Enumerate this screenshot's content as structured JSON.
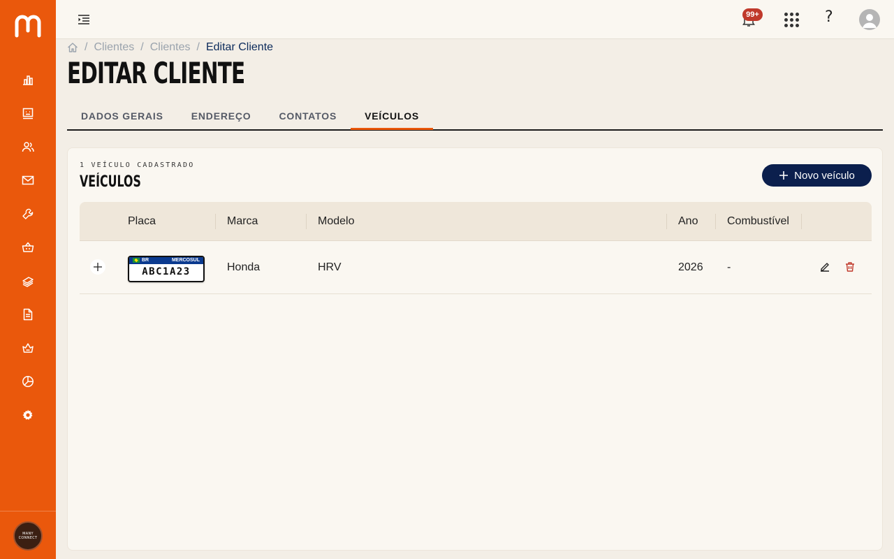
{
  "sidebar": {
    "items": [
      {
        "icon": "chart-bar-icon"
      },
      {
        "icon": "board-icon"
      },
      {
        "icon": "users-icon"
      },
      {
        "icon": "mail-icon"
      },
      {
        "icon": "wrench-icon"
      },
      {
        "icon": "basket-icon"
      },
      {
        "icon": "money-icon"
      },
      {
        "icon": "document-icon"
      },
      {
        "icon": "crown-basket-icon"
      },
      {
        "icon": "pie-chart-icon"
      },
      {
        "icon": "gear-icon"
      }
    ],
    "account_avatar_line1": "MANY",
    "account_avatar_line2": "CONNECT"
  },
  "topbar": {
    "notification_count": "99+"
  },
  "breadcrumb": {
    "items": [
      "Clientes",
      "Clientes"
    ],
    "current": "Editar Cliente",
    "separator": "/"
  },
  "page": {
    "title": "EDITAR CLIENTE"
  },
  "tabs": [
    {
      "label": "DADOS GERAIS",
      "active": false
    },
    {
      "label": "ENDEREÇO",
      "active": false
    },
    {
      "label": "CONTATOS",
      "active": false
    },
    {
      "label": "VEÍCULOS",
      "active": true
    }
  ],
  "vehicles": {
    "kicker": "1 VEÍCULO CADASTRADO",
    "title": "VEÍCULOS",
    "new_button_label": "Novo veículo",
    "columns": {
      "placa": "Placa",
      "marca": "Marca",
      "modelo": "Modelo",
      "ano": "Ano",
      "combustivel": "Combustível"
    },
    "rows": [
      {
        "plate_country": "BR",
        "plate_region": "MERCOSUL",
        "placa": "ABC1A23",
        "marca": "Honda",
        "modelo": "HRV",
        "ano": "2026",
        "combustivel": "-"
      }
    ]
  },
  "colors": {
    "sidebar": "#ea580c",
    "accent": "#ea580c",
    "primary_button": "#0b1f4d",
    "delete": "#c0392b",
    "background": "#f3eee6"
  }
}
